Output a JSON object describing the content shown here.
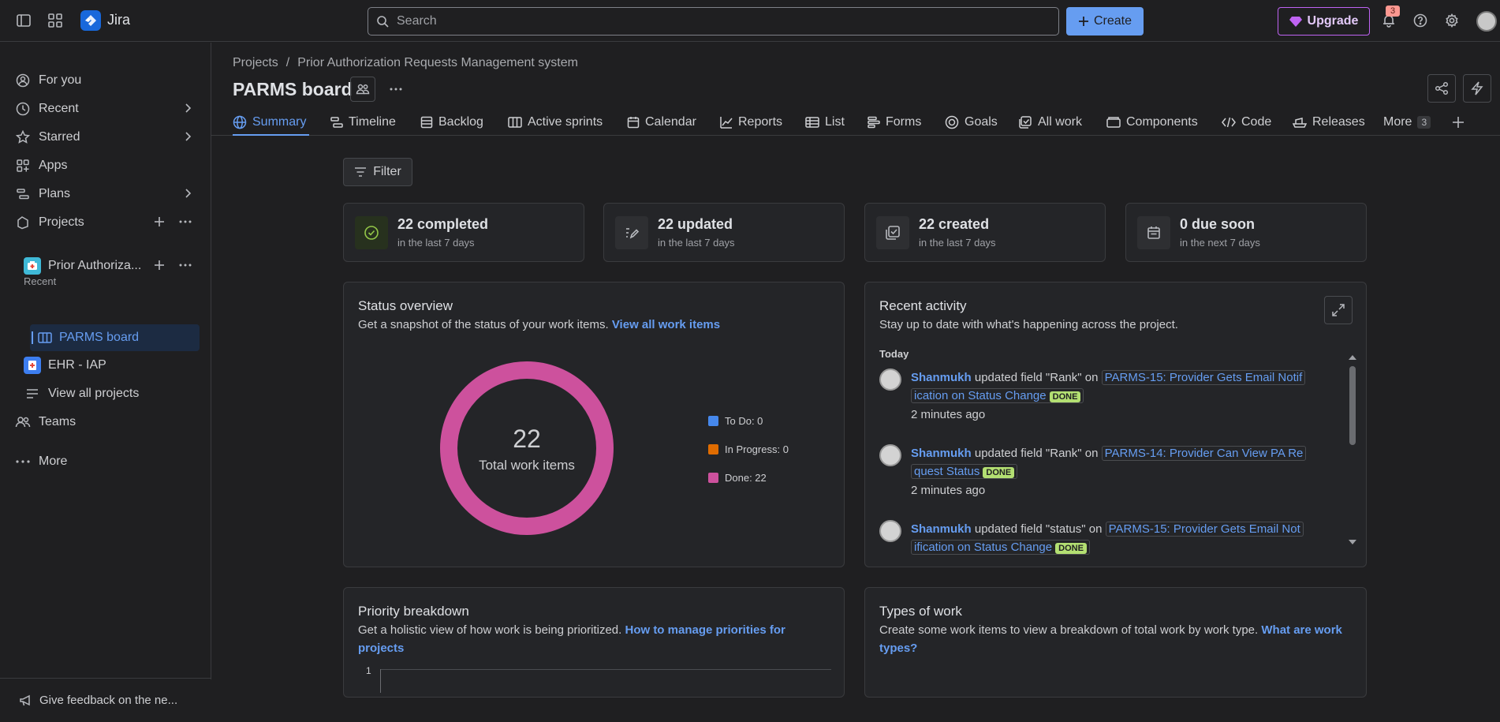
{
  "app": {
    "brand": "Jira"
  },
  "topbar": {
    "search_placeholder": "Search",
    "create_label": "Create",
    "upgrade_label": "Upgrade",
    "notification_count": "3"
  },
  "sidebar": {
    "items": [
      {
        "label": "For you"
      },
      {
        "label": "Recent"
      },
      {
        "label": "Starred"
      },
      {
        "label": "Apps"
      },
      {
        "label": "Plans"
      },
      {
        "label": "Projects"
      }
    ],
    "recent_header": "Recent",
    "projects": [
      {
        "label": "Prior Authoriza..."
      },
      {
        "label": "PARMS board"
      },
      {
        "label": "EHR - IAP"
      },
      {
        "label": "View all projects"
      }
    ],
    "teams_label": "Teams",
    "more_label": "More",
    "feedback_label": "Give feedback on the ne..."
  },
  "breadcrumb": {
    "root": "Projects",
    "sep": "/",
    "project": "Prior Authorization Requests Management system"
  },
  "page_title": "PARMS board",
  "tabs": [
    {
      "label": "Summary"
    },
    {
      "label": "Timeline"
    },
    {
      "label": "Backlog"
    },
    {
      "label": "Active sprints"
    },
    {
      "label": "Calendar"
    },
    {
      "label": "Reports"
    },
    {
      "label": "List"
    },
    {
      "label": "Forms"
    },
    {
      "label": "Goals"
    },
    {
      "label": "All work"
    },
    {
      "label": "Components"
    },
    {
      "label": "Code"
    },
    {
      "label": "Releases"
    },
    {
      "label": "More",
      "count": "3"
    }
  ],
  "filter_label": "Filter",
  "stats": [
    {
      "value": "22 completed",
      "sub": "in the last 7 days"
    },
    {
      "value": "22 updated",
      "sub": "in the last 7 days"
    },
    {
      "value": "22 created",
      "sub": "in the last 7 days"
    },
    {
      "value": "0 due soon",
      "sub": "in the next 7 days"
    }
  ],
  "status_overview": {
    "title": "Status overview",
    "desc": "Get a snapshot of the status of your work items.",
    "link": "View all work items",
    "total": "22",
    "total_label": "Total work items",
    "legend": [
      {
        "label": "To Do: 0",
        "color": "#4688ec"
      },
      {
        "label": "In Progress: 0",
        "color": "#e06c00"
      },
      {
        "label": "Done: 22",
        "color": "#cd519d"
      }
    ]
  },
  "chart_data": {
    "type": "pie",
    "categories": [
      "To Do",
      "In Progress",
      "Done"
    ],
    "values": [
      0,
      0,
      22
    ],
    "colors": [
      "#4688ec",
      "#e06c00",
      "#cd519d"
    ],
    "title": "Status overview"
  },
  "recent_activity": {
    "title": "Recent activity",
    "desc": "Stay up to date with what's happening across the project.",
    "day": "Today",
    "items": [
      {
        "user": "Shanmukh",
        "action": "updated field \"Rank\" on",
        "work": "PARMS-15: Provider Gets Email Notif",
        "work2": "ication on Status Change",
        "status": "DONE",
        "time": "2 minutes ago"
      },
      {
        "user": "Shanmukh",
        "action": "updated field \"Rank\" on",
        "work": "PARMS-14: Provider Can View PA Re",
        "work2": "quest Status",
        "status": "DONE",
        "time": "2 minutes ago"
      },
      {
        "user": "Shanmukh",
        "action": "updated field \"status\" on",
        "work": "PARMS-15: Provider Gets Email Not",
        "work2": "ification on Status Change",
        "status": "DONE",
        "time": ""
      }
    ]
  },
  "priority": {
    "title": "Priority breakdown",
    "desc": "Get a holistic view of how work is being prioritized.",
    "link": "How to manage priorities for projects",
    "tick": "1"
  },
  "types": {
    "title": "Types of work",
    "desc": "Create some work items to view a breakdown of total work by work type.",
    "link": "What are work types?"
  }
}
